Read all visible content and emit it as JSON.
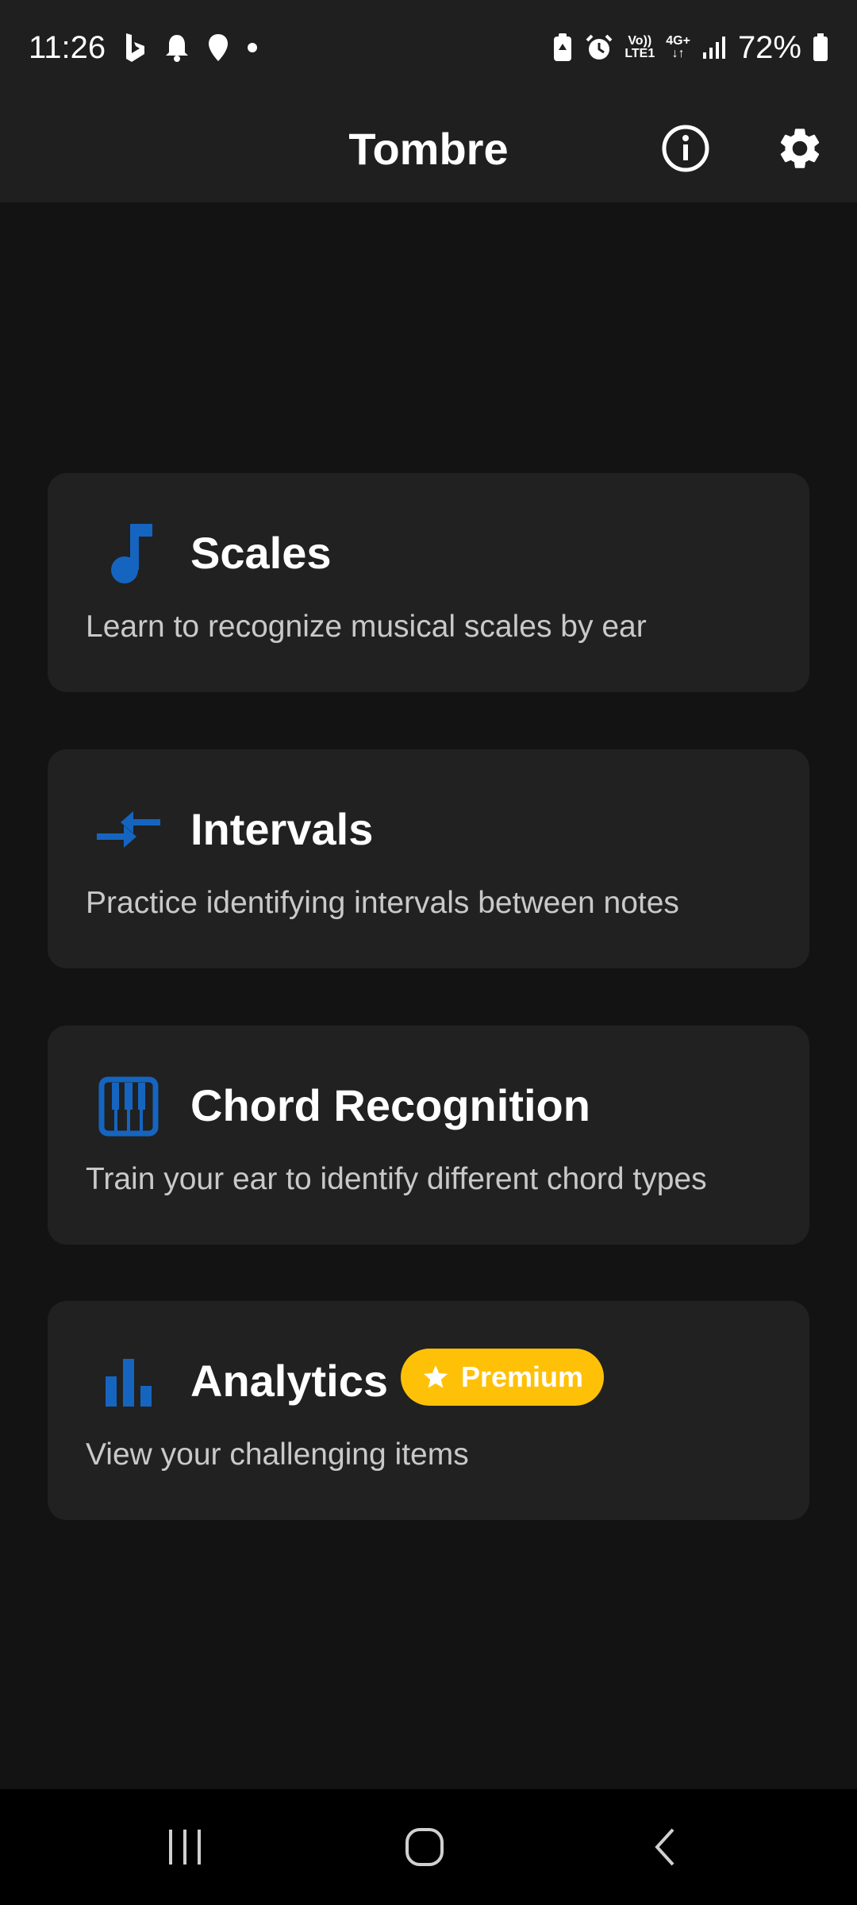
{
  "status_bar": {
    "time": "11:26",
    "battery": "72%",
    "network_top": "Vo))",
    "network_bottom": "LTE1",
    "data_type": "4G+",
    "icons": [
      "bing-icon",
      "bell-icon",
      "location-icon",
      "dot-icon",
      "battery-saver-icon",
      "alarm-icon",
      "signal-icon",
      "battery-icon"
    ]
  },
  "app_bar": {
    "title": "Tombre",
    "actions": [
      "info-icon",
      "settings-icon"
    ]
  },
  "cards": [
    {
      "title": "Scales",
      "description": "Learn to recognize musical scales by ear",
      "icon": "music-note-icon"
    },
    {
      "title": "Intervals",
      "description": "Practice identifying intervals between notes",
      "icon": "compare-arrows-icon"
    },
    {
      "title": "Chord Recognition",
      "description": "Train your ear to identify different chord types",
      "icon": "piano-icon"
    },
    {
      "title": "Analytics",
      "description": "View your challenging items",
      "icon": "bar-chart-icon",
      "badge": "Premium"
    }
  ],
  "colors": {
    "accent": "#1565c0",
    "badge": "#ffc107",
    "card": "#212121",
    "background": "#131313"
  },
  "nav_bar": [
    "recents-icon",
    "home-icon",
    "back-icon"
  ]
}
